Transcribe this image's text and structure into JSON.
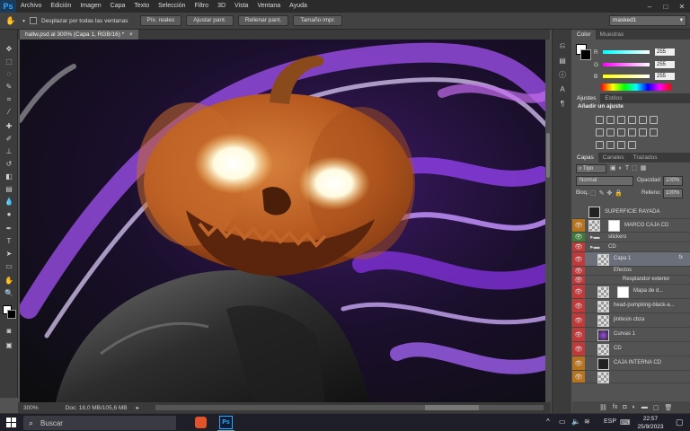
{
  "app": {
    "logo": "Ps"
  },
  "menu": [
    "Archivo",
    "Edición",
    "Imagen",
    "Capa",
    "Texto",
    "Selección",
    "Filtro",
    "3D",
    "Vista",
    "Ventana",
    "Ayuda"
  ],
  "window_controls": [
    "–",
    "□",
    "✕"
  ],
  "options": {
    "scroll_all_label": "Desplazar por todas las ventanas",
    "buttons": [
      "Píx. reales",
      "Ajustar pant.",
      "Rellenar pant.",
      "Tamaño impr."
    ],
    "layer_select": "masked1"
  },
  "document": {
    "tab_title": "hallw.psd al 300% (Capa 1, RGB/16) *",
    "close": "×"
  },
  "status": {
    "zoom": "300%",
    "doc_info": "Doc: 18,0 MB/105,6 MB"
  },
  "color_panel": {
    "tabs": [
      "Color",
      "Muestras"
    ],
    "rows": [
      {
        "label": "R",
        "value": "255"
      },
      {
        "label": "G",
        "value": "255"
      },
      {
        "label": "B",
        "value": "255"
      }
    ]
  },
  "adjust_panel": {
    "tabs": [
      "Ajustes",
      "Estilos"
    ],
    "title": "Añadir un ajuste"
  },
  "layers_panel": {
    "tabs": [
      "Capas",
      "Canales",
      "Trazados"
    ],
    "filter": "Tipo",
    "blend_mode": "Normal",
    "opacity_label": "Opacidad:",
    "opacity": "100%",
    "lock_label": "Bloq.:",
    "fill_label": "Relleno:",
    "fill": "100%",
    "layers": [
      {
        "name": "SUPERFICIE RAYADA",
        "tag": "#535353",
        "eye": ""
      },
      {
        "name": "MARCO CAJA CD",
        "tag": "#b8731f",
        "eye": "👁"
      },
      {
        "name": "stickers",
        "tag": "#3f7a3a",
        "eye": "👁"
      },
      {
        "name": "CD",
        "tag": "#c0393b",
        "eye": "👁"
      },
      {
        "name": "Capa 1",
        "tag": "#c0393b",
        "eye": "👁",
        "fx": "fx"
      },
      {
        "name": "Efectos",
        "tag": "#c0393b",
        "eye": "👁"
      },
      {
        "name": "Resplandor exterior",
        "tag": "#c0393b",
        "eye": "👁"
      },
      {
        "name": "Mapa de d...",
        "tag": "#c0393b",
        "eye": "👁"
      },
      {
        "name": "head-pumpking-black-a...",
        "tag": "#c0393b",
        "eye": "👁"
      },
      {
        "name": "jinitesin cbza",
        "tag": "#c0393b",
        "eye": "👁"
      },
      {
        "name": "Curvas 1",
        "tag": "#c0393b",
        "eye": "👁"
      },
      {
        "name": "CD",
        "tag": "#c0393b",
        "eye": "👁"
      },
      {
        "name": "CAJA INTERNA CD",
        "tag": "#b8731f",
        "eye": "👁"
      },
      {
        "name": "",
        "tag": "#b8731f",
        "eye": "👁"
      }
    ]
  },
  "taskbar": {
    "search_placeholder": "Buscar",
    "time": "22:57",
    "date": "25/9/2023",
    "lang": "ESP"
  }
}
